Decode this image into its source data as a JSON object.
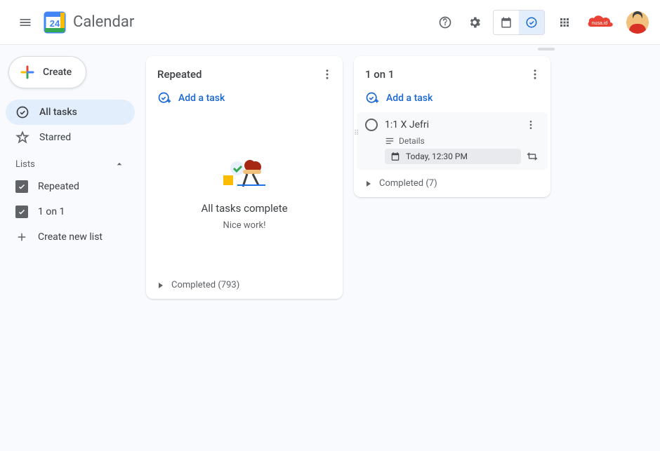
{
  "header": {
    "app_title": "Calendar",
    "logo_day": "24",
    "org_label": "nusa.id"
  },
  "sidebar": {
    "create_label": "Create",
    "items": [
      {
        "label": "All tasks",
        "icon": "check-circle",
        "active": true
      },
      {
        "label": "Starred",
        "icon": "star",
        "active": false
      }
    ],
    "lists_header": "Lists",
    "lists": [
      {
        "label": "Repeated",
        "checked": true
      },
      {
        "label": "1 on 1",
        "checked": true
      }
    ],
    "create_list_label": "Create new list"
  },
  "columns": {
    "repeated": {
      "title": "Repeated",
      "add_task_label": "Add a task",
      "empty_title": "All tasks complete",
      "empty_sub": "Nice work!",
      "completed_label": "Completed (793)"
    },
    "one_on_one": {
      "title": "1 on 1",
      "add_task_label": "Add a task",
      "task": {
        "title": "1:1 X Jefri",
        "details_label": "Details",
        "date_label": "Today, 12:30 PM"
      },
      "completed_label": "Completed (7)"
    }
  }
}
